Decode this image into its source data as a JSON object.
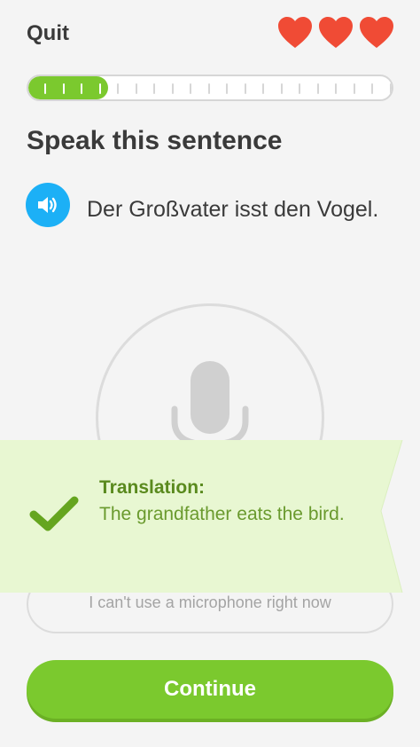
{
  "header": {
    "quit_label": "Quit",
    "hearts_count": 3,
    "heart_color": "#f04b35"
  },
  "progress": {
    "completed": 4,
    "total": 20,
    "fill_color": "#7bc92e"
  },
  "prompt": {
    "title": "Speak this sentence",
    "sentence": "Der Großvater isst den Vogel.",
    "speaker_icon": "speaker-icon",
    "accent_color": "#1cb0f6"
  },
  "microphone": {
    "icon": "microphone-icon"
  },
  "alt_button": {
    "label": "I can't use a microphone right now"
  },
  "feedback": {
    "status_icon": "checkmark-icon",
    "label": "Translation:",
    "text": "The grandfather eats the bird.",
    "bg_color": "#e8f7d2",
    "text_color": "#6a9a2e"
  },
  "footer": {
    "continue_label": "Continue",
    "button_color": "#7bc92e"
  }
}
